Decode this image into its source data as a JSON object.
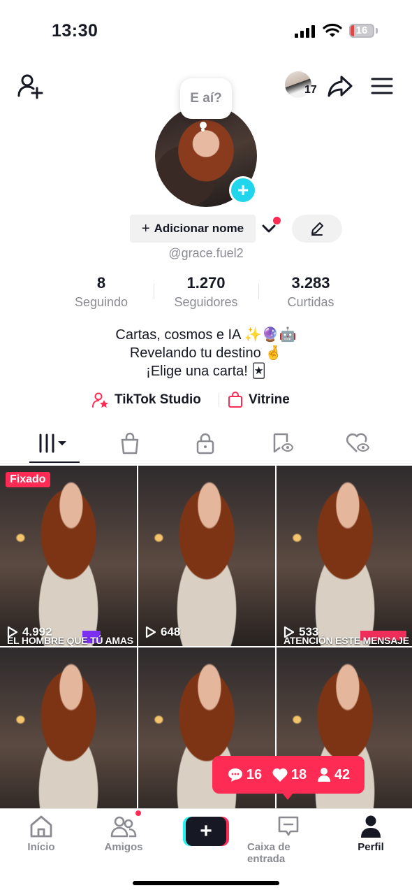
{
  "status_bar": {
    "time": "13:30",
    "battery": "16",
    "battery_level": 0.16
  },
  "header": {
    "friend_count": "17",
    "bubble_text": "E aí?"
  },
  "profile": {
    "add_name_label": "Adicionar nome",
    "username": "@grace.fuel2",
    "stats": [
      {
        "value": "8",
        "label": "Seguindo"
      },
      {
        "value": "1.270",
        "label": "Seguidores"
      },
      {
        "value": "3.283",
        "label": "Curtidas"
      }
    ],
    "bio": [
      "Cartas, cosmos e IA ✨🔮🤖",
      "Revelando tu destino 🤞",
      "¡Elige una carta! 🃏"
    ],
    "links": {
      "studio": "TikTok Studio",
      "vitrine": "Vitrine"
    }
  },
  "tabs": [
    "videos-grid-icon",
    "shop-bag-icon",
    "lock-icon",
    "reposts-icon",
    "liked-heart-icon"
  ],
  "videos": [
    {
      "pinned_label": "Fixado",
      "views": "4.992",
      "caption": "EL HOMBRE QUE TÚ AMAS"
    },
    {
      "pinned_label": "",
      "views": "648",
      "caption": ""
    },
    {
      "pinned_label": "",
      "views": "533",
      "caption": "ATENCIÓN ESTE MENSAJE"
    },
    {
      "pinned_label": "",
      "views": "",
      "caption": ""
    },
    {
      "pinned_label": "",
      "views": "",
      "caption": ""
    },
    {
      "pinned_label": "",
      "views": "",
      "caption": ""
    }
  ],
  "notification": {
    "comments": "16",
    "likes": "18",
    "followers": "42"
  },
  "nav": {
    "home": "Início",
    "friends": "Amigos",
    "inbox": "Caixa de entrada",
    "profile": "Perfil"
  },
  "colors": {
    "accent": "#fe2c55",
    "cyan": "#20d5ec",
    "text": "#161823",
    "muted": "#8a8b91"
  }
}
